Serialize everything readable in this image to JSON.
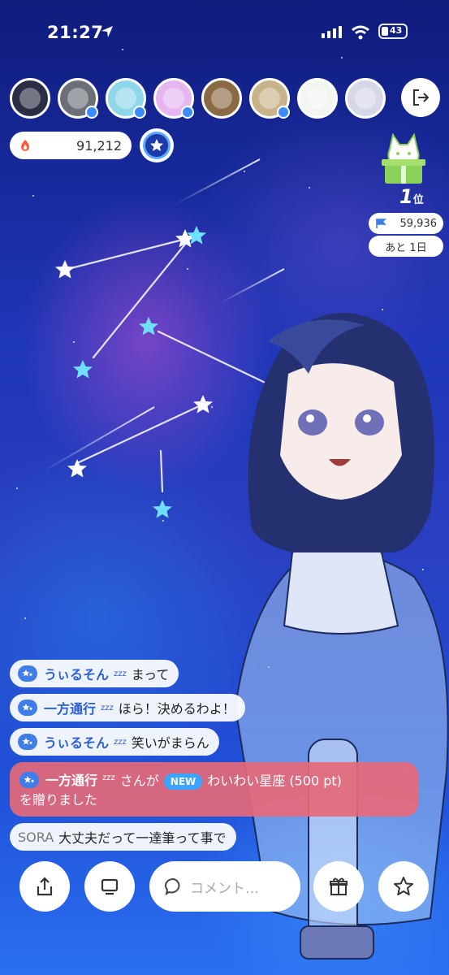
{
  "status_bar": {
    "time": "21:27",
    "battery": "43"
  },
  "viewers": [
    {
      "name": "viewer-1",
      "color": "#2b2d44",
      "badge": false
    },
    {
      "name": "viewer-2",
      "color": "#6b7078",
      "badge": true
    },
    {
      "name": "viewer-3",
      "color": "#8fd6e8",
      "badge": true
    },
    {
      "name": "viewer-4",
      "color": "#e5b6f0",
      "badge": true
    },
    {
      "name": "viewer-5",
      "color": "#8a6a44",
      "badge": false
    },
    {
      "name": "viewer-6",
      "color": "#c8b48a",
      "badge": true
    },
    {
      "name": "viewer-7",
      "color": "#f2f5f0",
      "badge": false
    },
    {
      "name": "viewer-8",
      "color": "#d6d8ea",
      "badge": false
    }
  ],
  "stats": {
    "points": "91,212"
  },
  "ranking": {
    "position": "1",
    "position_unit": "位",
    "score": "59,936",
    "remaining": "あと 1日"
  },
  "comments": [
    {
      "name": "うぃるそん",
      "zz": "zzz",
      "text": "まって"
    },
    {
      "name": "一方通行",
      "zz": "zzz",
      "text": "ほら！決めるわよ！"
    },
    {
      "name": "うぃるそん",
      "zz": "zzz",
      "text": "笑いがまらん"
    }
  ],
  "gift_notice": {
    "name": "一方通行",
    "zz": "zzz",
    "suffix": "さんが",
    "badge": "NEW",
    "gift": "わいわい星座 (500 pt)",
    "line2": "を贈りました"
  },
  "last_comment": {
    "name": "SORA",
    "text": "大丈夫だって一達筆って事で"
  },
  "bottom_bar": {
    "comment_placeholder": "コメント…"
  },
  "colors": {
    "accent": "#3f7de8",
    "gift_bg": "#e66978",
    "new_badge": "#3ba4ff"
  }
}
